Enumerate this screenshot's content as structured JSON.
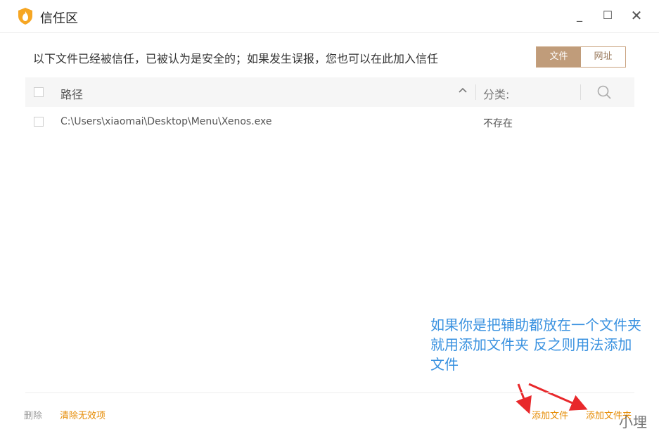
{
  "window": {
    "title": "信任区",
    "minimize_label": "_",
    "maximize_label": "☐",
    "close_label": "✕"
  },
  "intro_text": "以下文件已经被信任，已被认为是安全的；如果发生误报，您也可以在此加入信任",
  "tabs": {
    "file": "文件",
    "url": "网址"
  },
  "table": {
    "headers": {
      "path": "路径",
      "category": "分类:"
    },
    "rows": [
      {
        "path": "C:\\Users\\xiaomai\\Desktop\\Menu\\Xenos.exe",
        "category": "不存在"
      }
    ]
  },
  "annotation": {
    "lines": [
      "如果你是把辅助都放在一个文件夹",
      "就用添加文件夹 反之则用法添加",
      "文件"
    ],
    "color": "#3a92e0"
  },
  "footer": {
    "delete": "删除",
    "clear_invalid": "清除无效项",
    "add_file": "添加文件",
    "add_folder": "添加文件夹"
  },
  "watermark": "小埋",
  "colors": {
    "accent": "#c09c7a",
    "action_orange": "#e58a00",
    "arrow_red": "#e8282b"
  }
}
